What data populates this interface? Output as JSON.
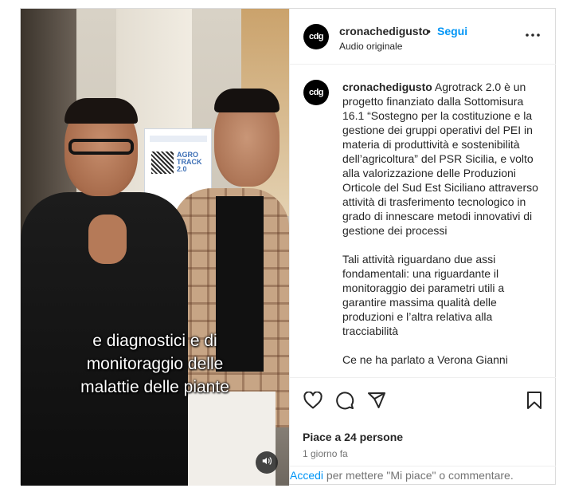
{
  "header": {
    "avatar_text": "cdg",
    "username": "cronachedigusto",
    "separator": "•",
    "follow_label": "Segui",
    "audio_label": "Audio originale"
  },
  "media": {
    "caption": "e diagnostici e di\nmonitoraggio delle\nmalattie delle piante",
    "poster_text": "AGRO\nTRACK\n2.0"
  },
  "post": {
    "avatar_text": "cdg",
    "username": "cronachedigusto",
    "body": " Agrotrack 2.0 è un progetto finanziato dalla Sottomisura 16.1 “Sostegno per la costituzione e la gestione dei gruppi operativi del PEI in materia di produttività e sostenibilità dell’agricoltura” del PSR Sicilia, e volto alla valorizzazione delle Produzioni Orticole del Sud Est Siciliano attraverso attività di trasferimento tecnologico in grado di innescare metodi innovativi di gestione dei processi\n\nTali attività riguardano due assi fondamentali: una riguardante il monitoraggio dei parametri utili a garantire massima qualità delle produzioni e l’altra relativa alla tracciabilità\n\nCe ne ha parlato a Verona Gianni"
  },
  "footer": {
    "likes": "Piace a 24 persone",
    "date": "1 giorno fa",
    "login_link": "Accedi",
    "login_rest": " per mettere \"Mi piace\" o commentare."
  },
  "icons": {
    "like": "heart-icon",
    "comment": "comment-icon",
    "share": "share-icon",
    "save": "bookmark-icon",
    "more": "more-options-icon",
    "sound": "speaker-icon"
  },
  "colors": {
    "follow": "#0095f6",
    "text": "#262626",
    "muted": "#737373",
    "border": "#dbdbdb"
  }
}
